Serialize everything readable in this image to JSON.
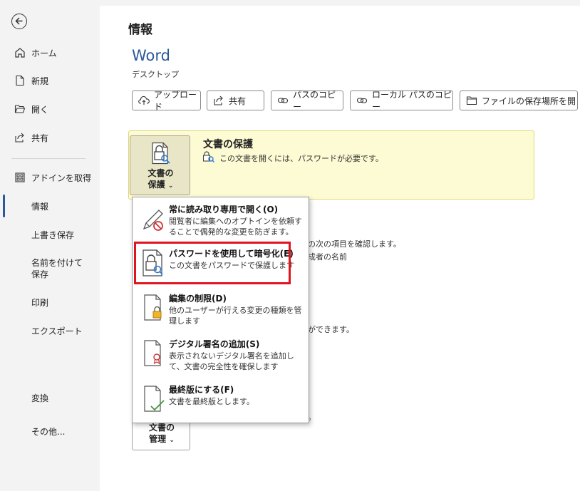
{
  "sidebar": {
    "items": [
      {
        "label": "ホーム"
      },
      {
        "label": "新規"
      },
      {
        "label": "開く"
      },
      {
        "label": "共有"
      },
      {
        "label": "アドインを取得"
      },
      {
        "label": "情報"
      },
      {
        "label": "上書き保存"
      },
      {
        "label": "名前を付けて保存"
      },
      {
        "label": "印刷"
      },
      {
        "label": "エクスポート"
      },
      {
        "label": "変換"
      },
      {
        "label": "その他..."
      }
    ],
    "selected": "情報"
  },
  "header": {
    "title": "情報",
    "app_name": "Word",
    "location": "デスクトップ"
  },
  "toolbar": {
    "upload": "アップロード",
    "share": "共有",
    "copy_path": "パスのコピー",
    "copy_local_path": "ローカル パスのコピー",
    "open_location": "ファイルの保存場所を開く"
  },
  "protect": {
    "button_line1": "文書の",
    "button_line2": "保護",
    "title": "文書の保護",
    "description": "この文書を開くには、パスワードが必要です。"
  },
  "background_text": {
    "line1": "の次の項目を確認します。",
    "line2": "成者の名前",
    "line3": "ができます。",
    "line4": "。"
  },
  "manage": {
    "line1": "文書の",
    "line2": "管理"
  },
  "menu": {
    "items": [
      {
        "title": "常に読み取り専用で開く(O)",
        "desc": "閲覧者に編集へのオプトインを依頼することで偶発的な変更を防ぎます。"
      },
      {
        "title": "パスワードを使用して暗号化(E)",
        "desc": "この文書をパスワードで保護します"
      },
      {
        "title": "編集の制限(D)",
        "desc": "他のユーザーが行える変更の種類を管理します"
      },
      {
        "title": "デジタル署名の追加(S)",
        "desc": "表示されないデジタル署名を追加して、文書の完全性を確保します"
      },
      {
        "title": "最終版にする(F)",
        "desc": "文書を最終版とします。"
      }
    ]
  },
  "colors": {
    "accent": "#2b579a",
    "protect_bg": "#fdfbd3",
    "highlight": "#e0141e"
  }
}
